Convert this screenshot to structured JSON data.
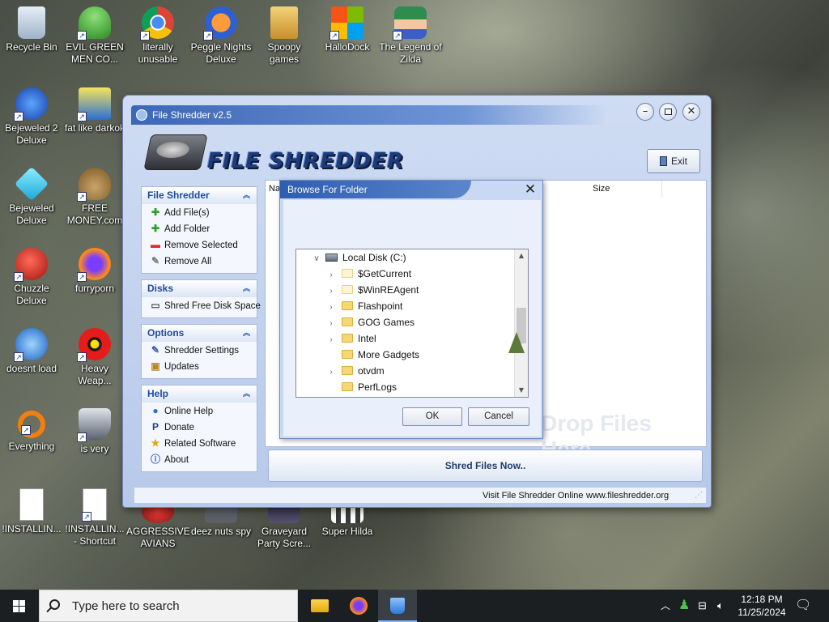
{
  "desktop": {
    "icons": [
      {
        "label": "Recycle Bin"
      },
      {
        "label": "EVIL GREEN MEN CO..."
      },
      {
        "label": "literally unusable"
      },
      {
        "label": "Peggle Nights Deluxe"
      },
      {
        "label": "Spoopy games"
      },
      {
        "label": "HalloDock"
      },
      {
        "label": "The Legend of Zilda"
      },
      {
        "label": "Bejeweled 2 Deluxe"
      },
      {
        "label": "fat like darkok"
      },
      {
        "label": "Bejeweled Deluxe"
      },
      {
        "label": "FREE MONEY.com"
      },
      {
        "label": "Chuzzle Deluxe"
      },
      {
        "label": "furryporn"
      },
      {
        "label": "doesnt load"
      },
      {
        "label": "Heavy Weap..."
      },
      {
        "label": "Everything"
      },
      {
        "label": "is very"
      },
      {
        "label": "!INSTALLIN..."
      },
      {
        "label": "!INSTALLIN... - Shortcut"
      },
      {
        "label": "AGGRESSIVE AVIANS"
      },
      {
        "label": "deez nuts spy"
      },
      {
        "label": "Graveyard Party Scre..."
      },
      {
        "label": "Super Hilda"
      }
    ]
  },
  "app": {
    "window_title": "File Shredder v2.5",
    "title": "FILE SHREDDER",
    "exit_label": "Exit",
    "panels": {
      "file_shredder": {
        "title": "File Shredder",
        "items": [
          "Add File(s)",
          "Add Folder",
          "Remove Selected",
          "Remove All"
        ]
      },
      "disks": {
        "title": "Disks",
        "items": [
          "Shred Free Disk Space"
        ]
      },
      "options": {
        "title": "Options",
        "items": [
          "Shredder Settings",
          "Updates"
        ]
      },
      "help": {
        "title": "Help",
        "items": [
          "Online Help",
          "Donate",
          "Related Software",
          "About"
        ]
      }
    },
    "list": {
      "columns": [
        "Na",
        "Size"
      ],
      "drop_hint": "Drop Files Here"
    },
    "shred_button": "Shred Files Now..",
    "status": {
      "visit_text": "Visit File Shredder Online",
      "url": "www.fileshredder.org"
    }
  },
  "dialog": {
    "title": "Browse For Folder",
    "drive": "Local Disk (C:)",
    "folders": [
      {
        "name": "$GetCurrent",
        "expandable": true,
        "hidden": true
      },
      {
        "name": "$WinREAgent",
        "expandable": true,
        "hidden": true
      },
      {
        "name": "Flashpoint",
        "expandable": true,
        "hidden": false
      },
      {
        "name": "GOG Games",
        "expandable": true,
        "hidden": false
      },
      {
        "name": "Intel",
        "expandable": true,
        "hidden": false
      },
      {
        "name": "More Gadgets",
        "expandable": false,
        "hidden": false
      },
      {
        "name": "otvdm",
        "expandable": true,
        "hidden": false
      },
      {
        "name": "PerfLogs",
        "expandable": false,
        "hidden": false
      }
    ],
    "ok_label": "OK",
    "cancel_label": "Cancel"
  },
  "taskbar": {
    "search_placeholder": "Type here to search",
    "time": "12:18 PM",
    "date": "11/25/2024"
  },
  "colors": {
    "accent": "#2f5db0",
    "panel_header_text": "#1f4a9c",
    "taskbar": "#1c1f22"
  }
}
